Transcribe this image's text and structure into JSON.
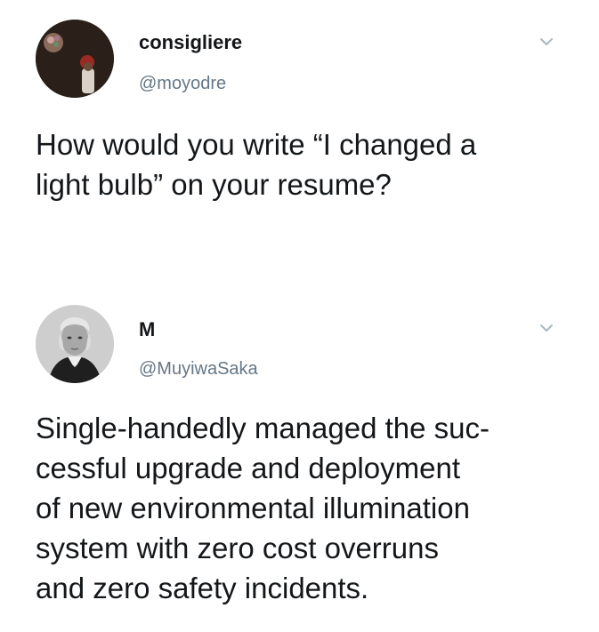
{
  "tweets": [
    {
      "display_name": "consigliere",
      "handle": "@moyodre",
      "text": "How would you write “I changed a\nlight bulb” on your resume?",
      "avatar_icon": "profile-photo-icon",
      "menu_icon": "chevron-down-icon"
    },
    {
      "display_name": "M",
      "handle": "@MuyiwaSaka",
      "text": "Single-handedly managed the suc-\ncessful upgrade and deployment\nof new environmental illumination\nsystem with zero cost overruns\nand zero safety incidents.",
      "avatar_icon": "vintage-portrait-icon",
      "menu_icon": "chevron-down-icon"
    }
  ],
  "colors": {
    "text": "#14171a",
    "secondary_text": "#657786",
    "chevron": "#aab8c2",
    "background": "#ffffff"
  }
}
